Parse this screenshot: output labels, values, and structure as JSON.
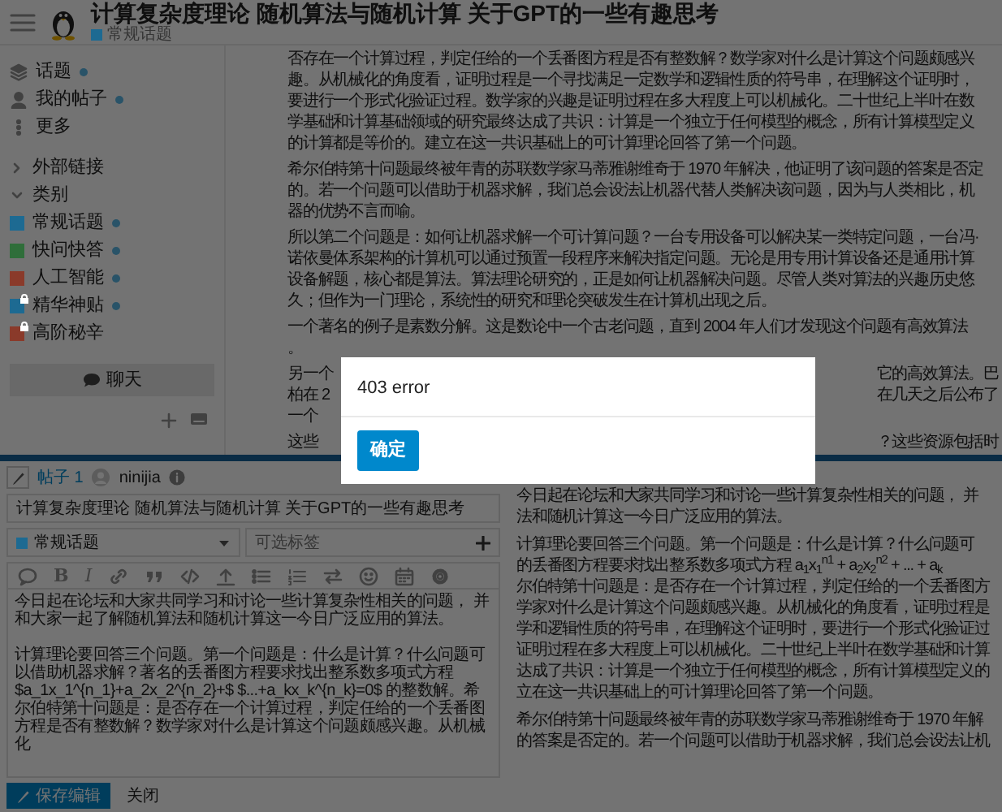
{
  "header": {
    "title": "计算复杂度理论 随机算法与随机计算 关于GPT的一些有趣思考",
    "category": {
      "label": "常规话题",
      "color": "#1d6a92"
    }
  },
  "sidebar": {
    "items": [
      {
        "label": "话题",
        "unread": true
      },
      {
        "label": "我的帖子",
        "unread": true
      },
      {
        "label": "更多",
        "unread": false
      }
    ],
    "sections": [
      {
        "label": "外部链接",
        "expanded": false
      },
      {
        "label": "类别",
        "expanded": true,
        "categories": [
          {
            "label": "常规话题",
            "color": "#1d6a92",
            "locked": false,
            "unread": true
          },
          {
            "label": "快问快答",
            "color": "#2f6e3a",
            "locked": false,
            "unread": true
          },
          {
            "label": "人工智能",
            "color": "#8a3a2a",
            "locked": false,
            "unread": true
          },
          {
            "label": "精华神贴",
            "color": "#1d6a92",
            "locked": true,
            "unread": true
          },
          {
            "label": "高阶秘辛",
            "color": "#8a3a2a",
            "locked": true,
            "unread": false
          }
        ]
      }
    ],
    "chat_button": "聊天"
  },
  "post": {
    "paragraphs": [
      [
        [
          "否存在一个计算过程，判定任给的一个丢番图方程是否有整数解？数学家对什么是计算这个问题颇感兴"
        ],
        [
          "趣。从机械化的角度看，证明过程是一个寻找满足一定数学和逻辑性质的符号串，在理解这个证明时，"
        ],
        [
          "要进行一个形式化验证过程。数学家的兴趣是证明过程在多大程度上可以机械化。二十世纪上半叶在数"
        ],
        [
          "学基础和计算基础领域的研究最终达成了共识：计算是一个独立于任何模型的概念，所有计算模型定义"
        ],
        [
          "的计算都是等价的。建立在这一共识基础上的可计算理论回答了第一个问题。"
        ]
      ],
      [
        [
          "希尔伯特第十问题最终被年青的苏联数学家马蒂雅谢维奇于 1970 年解决，他证明了该问题的答案是否定"
        ],
        [
          "的。若一个问题可以借助于机器求解，我们总会设法让机器代替人类解决该问题，因为与人类相比，机"
        ],
        [
          "器的优势不言而喻。"
        ]
      ],
      [
        [
          "所以第二个问题是：如何让机器求解一个可计算问题？一台专用设备可以解决某一类特定问题，一台冯·"
        ],
        [
          "诺依曼体系架构的计算机可以通过预置一段程序来解决指定问题。无论是用专用计算设备还是通用计算"
        ],
        [
          "设备解题，核心都是算法。算法理论研究的，正是如何让机器解决问题。尽管人类对算法的兴趣历史悠"
        ],
        [
          "久；但作为一门理论，系统性的研究和理论突破发生在计算机出现之后。"
        ]
      ],
      [
        [
          "一个著名的例子是素数分解。这是数论中一个古老问题，直到 2004 年人们才发现这个问题有高效算法"
        ],
        [
          "。"
        ]
      ],
      [
        [
          "另一个",
          "它的高效算法。巴"
        ],
        [
          "柏在 2",
          "在几天之后公布了"
        ],
        [
          "一个"
        ]
      ],
      [
        [
          "这些",
          "？这些资源包括时"
        ]
      ]
    ]
  },
  "modal": {
    "message": "403 error",
    "button": "确定"
  },
  "composer": {
    "post_link": "帖子 1",
    "username": "ninijia",
    "title": "计算复杂度理论 随机算法与随机计算 关于GPT的一些有趣思考",
    "category": {
      "label": "常规话题",
      "color": "#1d6a92"
    },
    "tags_placeholder": "可选标签",
    "format_buttons": [
      "B",
      "I"
    ],
    "body": [
      "今日起在论坛和大家共同学习和讨论一些计算复杂性相关的问题， 并和大家一起了解随机算法和随机计算这一今日广泛应用的算法。",
      "计算理论要回答三个问题。第一个问题是：什么是计算？什么问题可以借助机器求解？著名的丢番图方程要求找出整系数多项式方程 $a_1x_1^{n_1}+a_2x_2^{n_2}+$ $...+a_kx_k^{n_k}=0$ 的整数解。希尔伯特第十问题是：是否存在一个计算过程，判定任给的一个丢番图方程是否有整数解？数学家对什么是计算这个问题颇感兴趣。从机械化"
    ],
    "preview": [
      [
        "今日起在论坛和大家共同学习和讨论一些计算复杂性相关的问题， 并",
        "法和随机计算这一今日广泛应用的算法。"
      ],
      [
        "计算理论要回答三个问题。第一个问题是：什么是计算？什么问题可",
        "的丢番图方程要求找出整系数多项式方程 a$_{1}$x$_{1}$$^{n1}$ + a$_{2}$x$_{2}$$^{n2}$ + ... + a$_{k}$",
        "尔伯特第十问题是：是否存在一个计算过程，判定任给的一个丢番图方",
        "学家对什么是计算这个问题颇感兴趣。从机械化的角度看，证明过程是",
        "学和逻辑性质的符号串，在理解这个证明时，要进行一个形式化验证过",
        "证明过程在多大程度上可以机械化。二十世纪上半叶在数学基础和计算",
        "达成了共识：计算是一个独立于任何模型的概念，所有计算模型定义的",
        "立在这一共识基础上的可计算理论回答了第一个问题。"
      ],
      [
        "希尔伯特第十问题最终被年青的苏联数学家马蒂雅谢维奇于 1970 年解",
        "的答案是否定的。若一个问题可以借助于机器求解，我们总会设法让机"
      ]
    ],
    "save_button": "保存编辑",
    "close_link": "关闭"
  }
}
